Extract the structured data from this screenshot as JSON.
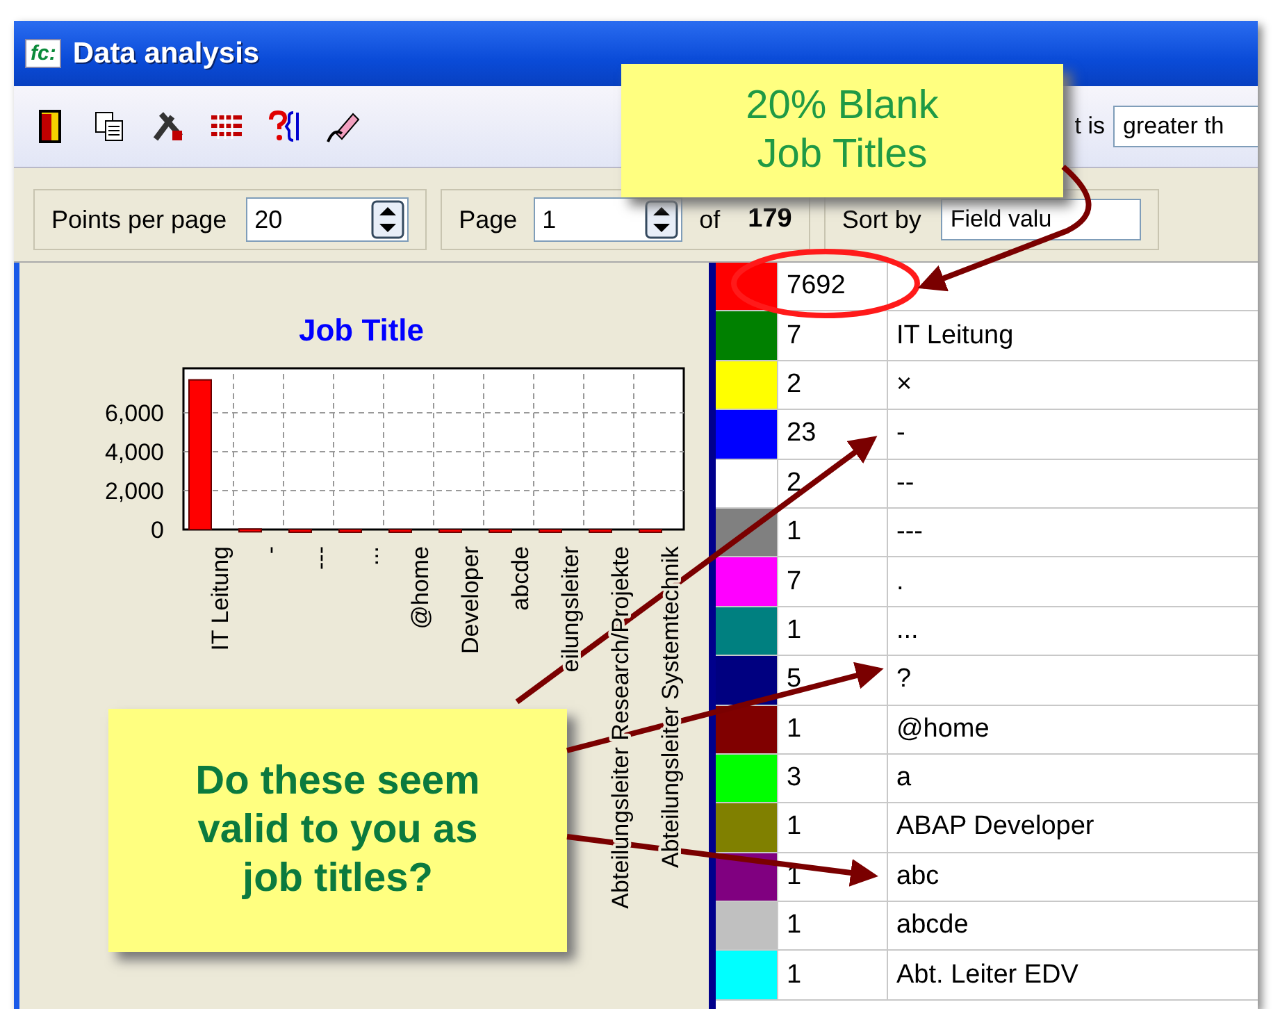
{
  "window": {
    "logo": "fc:",
    "title": "Data analysis"
  },
  "toolbar": {
    "filter_label": "t is",
    "filter_value": "greater th"
  },
  "paging": {
    "points_label": "Points per page",
    "points_value": "20",
    "page_label": "Page",
    "page_value": "1",
    "of_label": "of",
    "page_count": "179",
    "sort_label": "Sort by",
    "sort_value": "Field valu"
  },
  "chart": {
    "chart_data": {
      "type": "bar",
      "title": "Job Title",
      "categories": [
        "IT Leitung",
        "-",
        "---",
        "...",
        "@home",
        "Developer",
        "abcde",
        "eilungsleiter",
        "Abteilungsleiter Research/Projekte",
        "Abteilungsleiter Systemtechnik"
      ],
      "series": [
        {
          "color": "#ff0000",
          "values": [
            7692,
            23,
            1,
            1,
            1,
            1,
            1,
            1,
            1,
            1
          ]
        }
      ],
      "grid": true,
      "ylim": [
        0,
        8000
      ],
      "yticks": [
        {
          "value": 0,
          "label": "0"
        },
        {
          "value": 2000,
          "label": "2,000"
        },
        {
          "value": 4000,
          "label": "4,000"
        },
        {
          "value": 6000,
          "label": "6,000"
        }
      ]
    }
  },
  "table": {
    "rows": [
      {
        "color": "#ff0000",
        "count": "7692"
      },
      {
        "color": "#008000",
        "count": "7",
        "value": "IT Leitung"
      },
      {
        "color": "#ffff00",
        "count": "2",
        "value": "×"
      },
      {
        "color": "#0000ff",
        "count": "23",
        "value": "-"
      },
      {
        "color": "#ffffff",
        "count": "2",
        "value": "--"
      },
      {
        "color": "#808080",
        "count": "1",
        "value": "---"
      },
      {
        "color": "#ff00ff",
        "count": "7",
        "value": "."
      },
      {
        "color": "#008080",
        "count": "1",
        "value": "..."
      },
      {
        "color": "#000080",
        "count": "5",
        "value": "?"
      },
      {
        "color": "#800000",
        "count": "1",
        "value": "@home"
      },
      {
        "color": "#00ff00",
        "count": "3",
        "value": "a"
      },
      {
        "color": "#808000",
        "count": "1",
        "value": "ABAP Developer"
      },
      {
        "color": "#800080",
        "count": "1",
        "value": "abc"
      },
      {
        "color": "#c0c0c0",
        "count": "1",
        "value": "abcde"
      },
      {
        "color": "#00ffff",
        "count": "1",
        "value": "Abt. Leiter EDV"
      }
    ]
  },
  "annotations": [
    {
      "kind": "note",
      "text": "20% Blank Job Titles"
    },
    {
      "kind": "question",
      "text": "Do these seem valid to you as job titles?"
    }
  ]
}
